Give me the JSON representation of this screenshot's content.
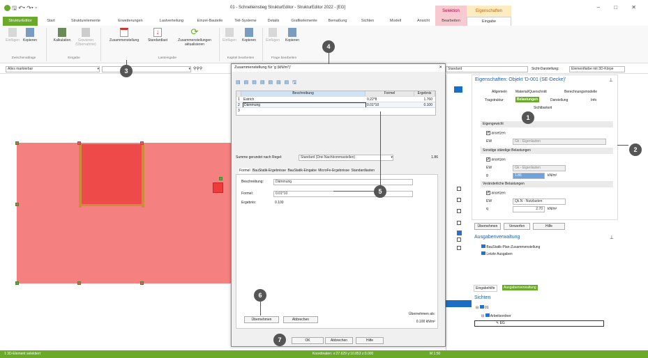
{
  "window": {
    "title": "01 - Schnelleinstieg StrukturEditor - StrukturEditor 2022 - [EG]",
    "controls": "–  □  ✕"
  },
  "context": {
    "group1": "Selektion",
    "group2": "Eigenschaften"
  },
  "tabs": [
    "StrukturEditor",
    "Start",
    "Strukturelemente",
    "Erweiterungen",
    "Lastverteilung",
    "Einzel-Bauteile",
    "Teil-Systeme",
    "Details",
    "Grafikelemente",
    "Bemaßung",
    "Sichten",
    "Modell",
    "Ansicht",
    "Bearbeiten",
    "Eingabe"
  ],
  "ribbon": {
    "einfuegen": "Einfügen",
    "kopieren": "Kopieren",
    "zwischenablage": "Zwischenablage",
    "kalkulation": "Kalkulation",
    "gravieren": "Gravieren",
    "uebernahme": "(Übernahme)",
    "eingabe": "Eingabe",
    "zusammenstellung": "Zusammenstellung",
    "standardlast": "Standardlast",
    "zus_akt": "Zusammenstellungen aktualisieren",
    "lasteingabe": "Lasteingabe",
    "einfuegen2": "Einfügen",
    "kopieren2": "Kopieren",
    "kapitel": "Kapitel bearbeiten",
    "einfuegen3": "Einfügen",
    "kopieren3": "Kopieren",
    "frage": "Frage bearbeiten"
  },
  "toolbar": {
    "filter": "Alles markierbar",
    "mid": "Standard",
    "sicht_label": "Sicht-Darstellung:",
    "sicht_value": "Elementfarbe mit 3D-Körpe"
  },
  "dialog": {
    "title": "Zusammenstellung für 'g (kN/m²)'",
    "col_desc": "Beschreibung",
    "col_formel": "Formel",
    "col_ergebnis": "Ergebnis",
    "rows": [
      {
        "n": "1",
        "desc": "Estrich",
        "formel": "0.22*8",
        "erg": "1.760"
      },
      {
        "n": "2",
        "desc": "Dämmung",
        "formel": "0.01*10",
        "erg": "0.100"
      },
      {
        "n": "3",
        "desc": "",
        "formel": "",
        "erg": ""
      }
    ],
    "summe_label": "Summe gerundet nach Regel:",
    "summe_regel": "Standard (Drei Nachkommastellen)",
    "summe_value": "1.86",
    "subtabs": [
      "Formel",
      "BauStatik-Ergebnisse",
      "BauStatik-Eingabe",
      "MicroFe-Ergebnisse",
      "Standardlasten"
    ],
    "beschreibung_label": "Beschreibung:",
    "beschreibung_value": "Dämmung",
    "formel_label": "Formel:",
    "formel_value": "0.01*10",
    "ergebnis_label": "Ergebnis:",
    "ergebnis_value": "0.100",
    "uebernehmen": "Übernehmen",
    "abbrechen": "Abbrechen",
    "uebernehmen_als": "Übernehmen als:",
    "uebernehmen_wert": "0.100 kN/m²",
    "ok": "OK",
    "abbrechen2": "Abbrechen",
    "hilfe": "Hilfe"
  },
  "props": {
    "title": "Eigenschaften: Objekt 'D-001 (SE-Decke)'",
    "tabs": [
      "Allgemein",
      "Material/Querschnitt",
      "Berechnungsmodelle",
      "Tragstruktur",
      "Belastungen",
      "Darstellung",
      "Info",
      "Sichtbarkeit"
    ],
    "eigengewicht": "Eigengewicht",
    "ansetzen": "ansetzen",
    "ew": "EW",
    "ew1": "Gk - Eigenlasten",
    "sonstige": "Sonstige ständige Belastungen",
    "ew2": "Gk - Eigenlasten",
    "g": "g",
    "g_val": "1.86",
    "g_unit": "kN/m²",
    "veraenderlich": "Veränderliche Belastungen",
    "ew3": "Qk.N - Nutzlasten",
    "q": "q",
    "q_val": "2.70",
    "q_unit": "kN/m²",
    "btn_uebernehmen": "Übernehmen",
    "btn_verwerfen": "Verwerfen",
    "btn_hilfe": "Hilfe"
  },
  "ausgabe": {
    "title": "Ausgabenverwaltung",
    "item1": "BauStatik-Plan-Zusammenstellung",
    "item2": "Letzte Ausgaben",
    "tab1": "Eingabehilfe",
    "tab2": "Ausgabenverwaltung"
  },
  "sichten": {
    "title": "Sichten",
    "n1": "01",
    "n2": "Arbeitsordner",
    "n3": "EG"
  },
  "status": {
    "left": "1 3D-Element selektiert",
    "coords": "Koordinaten: x:27.629  y:10.853  z:0.000",
    "m": "M 1:50"
  },
  "callouts": [
    "1",
    "2",
    "3",
    "4",
    "5",
    "6",
    "7"
  ]
}
